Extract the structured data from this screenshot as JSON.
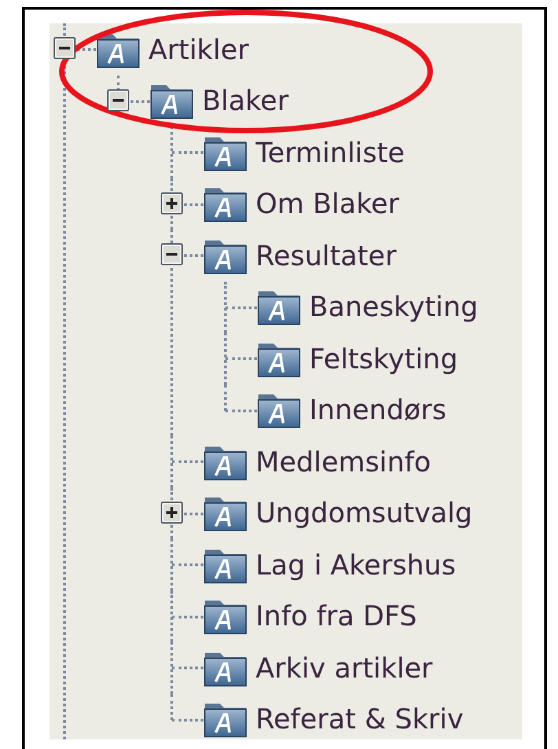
{
  "tree": [
    {
      "label": "Artikler",
      "expanded": true,
      "children": [
        {
          "label": "Blaker",
          "expanded": true,
          "children": [
            {
              "label": "Terminliste"
            },
            {
              "label": "Om Blaker",
              "expanded": false
            },
            {
              "label": "Resultater",
              "expanded": true,
              "children": [
                {
                  "label": "Baneskyting"
                },
                {
                  "label": "Feltskyting"
                },
                {
                  "label": "Innendørs"
                }
              ]
            },
            {
              "label": "Medlemsinfo"
            },
            {
              "label": "Ungdomsutvalg",
              "expanded": false
            },
            {
              "label": "Lag i Akershus"
            },
            {
              "label": "Info fra DFS"
            },
            {
              "label": "Arkiv artikler"
            },
            {
              "label": "Referat & Skriv"
            }
          ]
        }
      ]
    }
  ]
}
